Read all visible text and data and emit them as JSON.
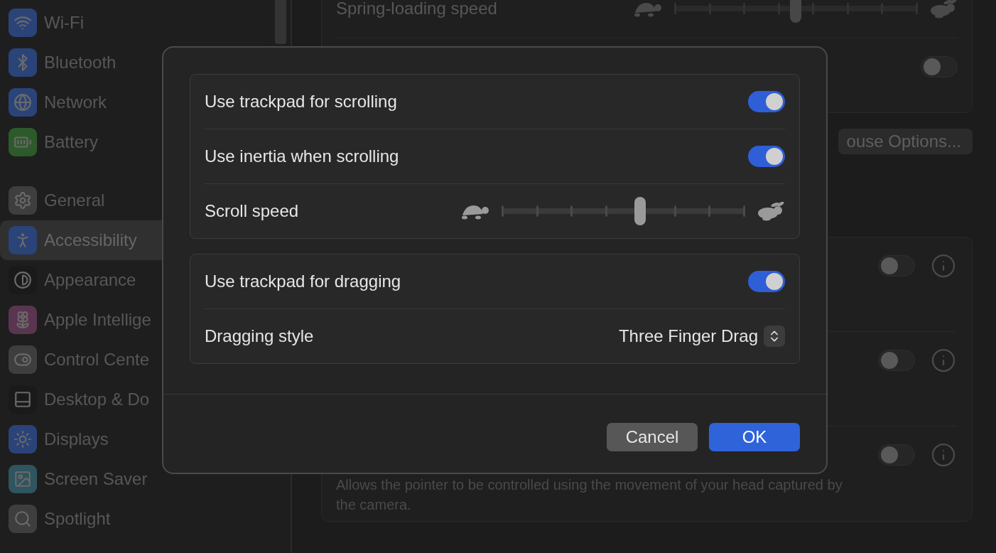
{
  "sidebar": {
    "items": [
      {
        "label": "Wi-Fi",
        "color": "#2a4479",
        "selected": false
      },
      {
        "label": "Bluetooth",
        "color": "#2a4479",
        "selected": false
      },
      {
        "label": "Network",
        "color": "#2a4479",
        "selected": false
      },
      {
        "label": "Battery",
        "color": "#2d5a2a",
        "selected": false
      },
      {
        "label": "General",
        "color": "#3e3e3e",
        "selected": false
      },
      {
        "label": "Accessibility",
        "color": "#2a4479",
        "selected": true
      },
      {
        "label": "Appearance",
        "color": "#1a1a1a",
        "selected": false
      },
      {
        "label": "Apple Intellige",
        "color": "#5a3550",
        "selected": false
      },
      {
        "label": "Control Cente",
        "color": "#3e3e3e",
        "selected": false
      },
      {
        "label": "Desktop & Do",
        "color": "#1a1a1a",
        "selected": false
      },
      {
        "label": "Displays",
        "color": "#2a4479",
        "selected": false
      },
      {
        "label": "Screen Saver",
        "color": "#2e5560",
        "selected": false
      },
      {
        "label": "Spotlight",
        "color": "#3e3e3e",
        "selected": false
      }
    ]
  },
  "trackpad_card": {
    "rows": [
      {
        "kind": "slider",
        "label": "Spring-loading speed",
        "level": 0.5
      },
      {
        "kind": "toggle",
        "on": false
      }
    ]
  },
  "mouse_options_button": "ouse Options...",
  "pointer_card": {
    "rows": [
      {
        "on": false
      },
      {
        "on": false
      },
      {
        "on": false,
        "description": "Allows the pointer to be controlled using the movement of your head captured by the camera."
      }
    ]
  },
  "dialog": {
    "groups": [
      {
        "rows": [
          {
            "kind": "toggle",
            "label": "Use trackpad for scrolling",
            "on": true
          },
          {
            "kind": "toggle",
            "label": "Use inertia when scrolling",
            "on": true
          },
          {
            "kind": "slider",
            "label": "Scroll speed",
            "level": 0.57
          }
        ]
      },
      {
        "rows": [
          {
            "kind": "toggle",
            "label": "Use trackpad for dragging",
            "on": true
          },
          {
            "kind": "popup",
            "label": "Dragging style",
            "value": "Three Finger Drag"
          }
        ]
      }
    ],
    "buttons": [
      {
        "label": "Cancel",
        "kind": "secondary"
      },
      {
        "label": "OK",
        "kind": "default"
      }
    ]
  }
}
